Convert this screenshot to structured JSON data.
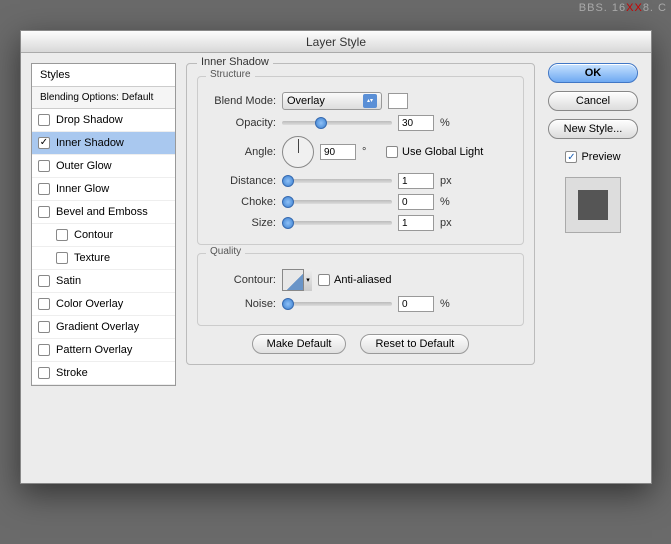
{
  "title": "Layer Style",
  "sidebar": {
    "header": "Styles",
    "sub": "Blending Options: Default",
    "items": [
      {
        "label": "Drop Shadow",
        "checked": false,
        "selected": false
      },
      {
        "label": "Inner Shadow",
        "checked": true,
        "selected": true
      },
      {
        "label": "Outer Glow",
        "checked": false,
        "selected": false
      },
      {
        "label": "Inner Glow",
        "checked": false,
        "selected": false
      },
      {
        "label": "Bevel and Emboss",
        "checked": false,
        "selected": false
      },
      {
        "label": "Contour",
        "checked": false,
        "selected": false,
        "indent": true
      },
      {
        "label": "Texture",
        "checked": false,
        "selected": false,
        "indent": true
      },
      {
        "label": "Satin",
        "checked": false,
        "selected": false
      },
      {
        "label": "Color Overlay",
        "checked": false,
        "selected": false
      },
      {
        "label": "Gradient Overlay",
        "checked": false,
        "selected": false
      },
      {
        "label": "Pattern Overlay",
        "checked": false,
        "selected": false
      },
      {
        "label": "Stroke",
        "checked": false,
        "selected": false
      }
    ]
  },
  "main": {
    "group_title": "Inner Shadow",
    "structure": {
      "title": "Structure",
      "blend_mode_label": "Blend Mode:",
      "blend_mode_value": "Overlay",
      "opacity_label": "Opacity:",
      "opacity_value": "30",
      "opacity_unit": "%",
      "angle_label": "Angle:",
      "angle_value": "90",
      "angle_unit": "°",
      "global_label": "Use Global Light",
      "global_checked": false,
      "distance_label": "Distance:",
      "distance_value": "1",
      "distance_unit": "px",
      "choke_label": "Choke:",
      "choke_value": "0",
      "choke_unit": "%",
      "size_label": "Size:",
      "size_value": "1",
      "size_unit": "px"
    },
    "quality": {
      "title": "Quality",
      "contour_label": "Contour:",
      "antialias_label": "Anti-aliased",
      "antialias_checked": false,
      "noise_label": "Noise:",
      "noise_value": "0",
      "noise_unit": "%"
    },
    "buttons": {
      "make_default": "Make Default",
      "reset_default": "Reset to Default"
    }
  },
  "right": {
    "ok": "OK",
    "cancel": "Cancel",
    "new_style": "New Style...",
    "preview": "Preview",
    "preview_checked": true
  }
}
